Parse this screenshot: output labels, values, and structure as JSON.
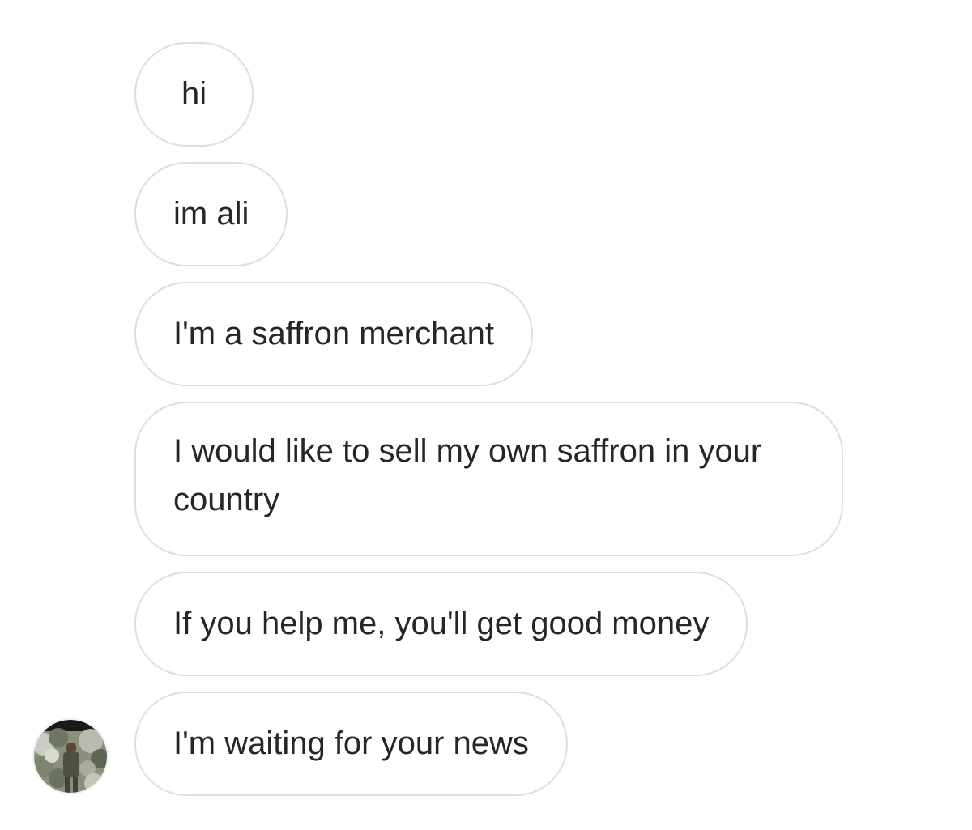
{
  "thread": {
    "messages": [
      {
        "text": "hi"
      },
      {
        "text": "im ali"
      },
      {
        "text": "I'm a saffron merchant"
      },
      {
        "text": "I would like to sell my own saffron in your country"
      },
      {
        "text": "If you help me, you'll get good money"
      },
      {
        "text": "I'm waiting for your news"
      }
    ],
    "sender_avatar": {
      "icon": "profile-photo-avatar"
    }
  },
  "colors": {
    "bubble_border": "#dedede",
    "text": "#262626",
    "background": "#ffffff"
  }
}
